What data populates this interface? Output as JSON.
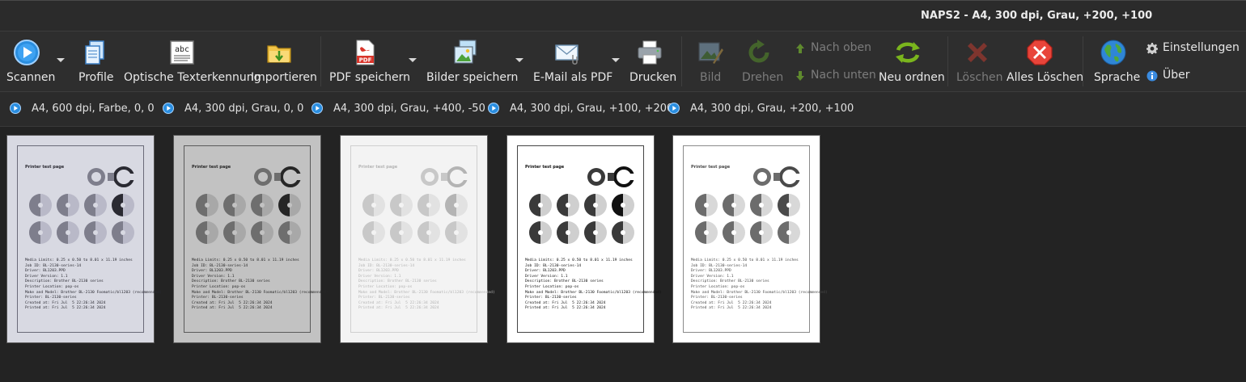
{
  "window": {
    "title": "NAPS2 - A4, 300 dpi, Grau, +200, +100"
  },
  "toolbar": {
    "scan": {
      "label": "Scannen",
      "icon": "scan-icon"
    },
    "profiles": {
      "label": "Profile",
      "icon": "profiles-icon"
    },
    "ocr": {
      "label": "Optische Texterkennung",
      "icon": "ocr-icon"
    },
    "import": {
      "label": "Importieren",
      "icon": "import-folder-icon"
    },
    "save_pdf": {
      "label": "PDF speichern",
      "icon": "pdf-icon"
    },
    "save_images": {
      "label": "Bilder speichern",
      "icon": "images-icon"
    },
    "email_pdf": {
      "label": "E-Mail als PDF",
      "icon": "email-icon"
    },
    "print": {
      "label": "Drucken",
      "icon": "printer-icon"
    },
    "image": {
      "label": "Bild",
      "icon": "image-edit-icon"
    },
    "rotate": {
      "label": "Drehen",
      "icon": "rotate-icon"
    },
    "move_up": {
      "label": "Nach oben",
      "icon": "arrow-up-icon"
    },
    "move_down": {
      "label": "Nach unten",
      "icon": "arrow-down-icon"
    },
    "reorder": {
      "label": "Neu ordnen",
      "icon": "reorder-icon"
    },
    "delete": {
      "label": "Löschen",
      "icon": "delete-x-icon"
    },
    "clear_all": {
      "label": "Alles Löschen",
      "icon": "clear-all-icon"
    },
    "language": {
      "label": "Sprache",
      "icon": "globe-icon"
    },
    "settings": {
      "label": "Einstellungen",
      "icon": "gear-icon"
    },
    "about": {
      "label": "Über",
      "icon": "info-icon"
    }
  },
  "profiles": [
    {
      "label": "A4, 600 dpi, Farbe, 0, 0"
    },
    {
      "label": "A4, 300 dpi, Grau, 0, 0"
    },
    {
      "label": "A4, 300 dpi, Grau, +400, -50"
    },
    {
      "label": "A4, 300 dpi, Grau, +100, +200"
    },
    {
      "label": "A4, 300 dpi, Grau, +200, +100"
    }
  ],
  "thumbnail_page": {
    "title": "Printer test page",
    "lines": [
      "Media Limits: 0.25 x 0.50 to 8.01 x 11.19 inches",
      "Job ID: BL-2130-series-14",
      "Driver: BL1203.PPD",
      "Driver Version: 1.1",
      "Description: Brother BL-2130 series",
      "Printer Location: pop-os",
      "Make and Model: Brother BL-2130 Foomatic/bl1203 (recommended)",
      "Printer: BL-2130-series",
      "Created at: Fri Jul  5 22:26:34 2024",
      "Printed at: Fri Jul  5 22:26:34 2024"
    ]
  },
  "colors": {
    "background": "#232323",
    "toolbar": "#2e2e2e",
    "text": "#e8e8e8",
    "disabled_text": "#7c7c7c",
    "scan_blue": "#2a8ee0",
    "green": "#7ab51d",
    "red": "#d9352b"
  }
}
